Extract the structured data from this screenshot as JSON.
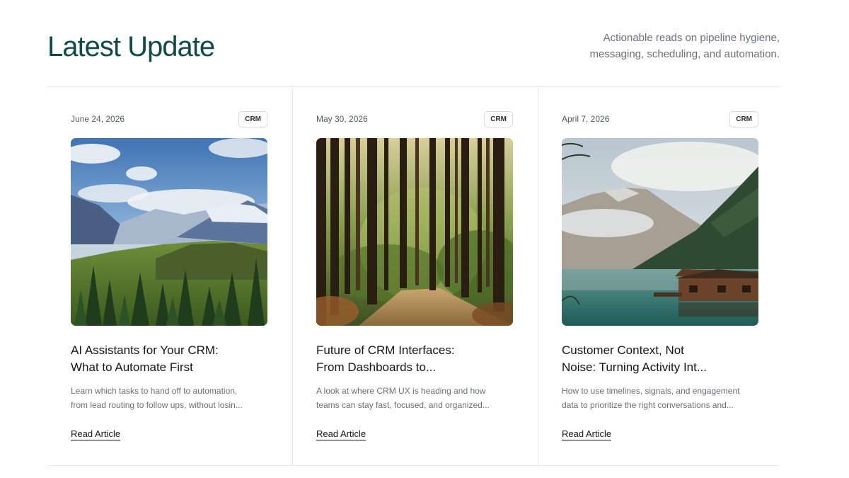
{
  "header": {
    "title": "Latest Update",
    "subtitle_line1": "Actionable reads on pipeline hygiene,",
    "subtitle_line2": "messaging, scheduling, and automation."
  },
  "articles": [
    {
      "date": "June 24, 2026",
      "tag": "CRM",
      "image": "mountain-valley-forest",
      "title_line1": "AI Assistants for Your CRM:",
      "title_line2": "What to Automate First",
      "excerpt_line1": "Learn which tasks to hand off to automation,",
      "excerpt_line2": "from lead routing to follow ups, without losin...",
      "link": "Read Article"
    },
    {
      "date": "May 30, 2026",
      "tag": "CRM",
      "image": "forest-path",
      "title_line1": "Future of CRM Interfaces:",
      "title_line2": "From Dashboards to...",
      "excerpt_line1": "A look at where CRM UX is heading and how",
      "excerpt_line2": "teams can stay fast, focused, and organized...",
      "link": "Read Article"
    },
    {
      "date": "April 7, 2026",
      "tag": "CRM",
      "image": "lake-cabin-mountains",
      "title_line1": "Customer Context, Not",
      "title_line2": "Noise: Turning Activity Int...",
      "excerpt_line1": "How to use timelines, signals, and engagement",
      "excerpt_line2": "data to prioritize the right conversations and...",
      "link": "Read Article"
    }
  ]
}
